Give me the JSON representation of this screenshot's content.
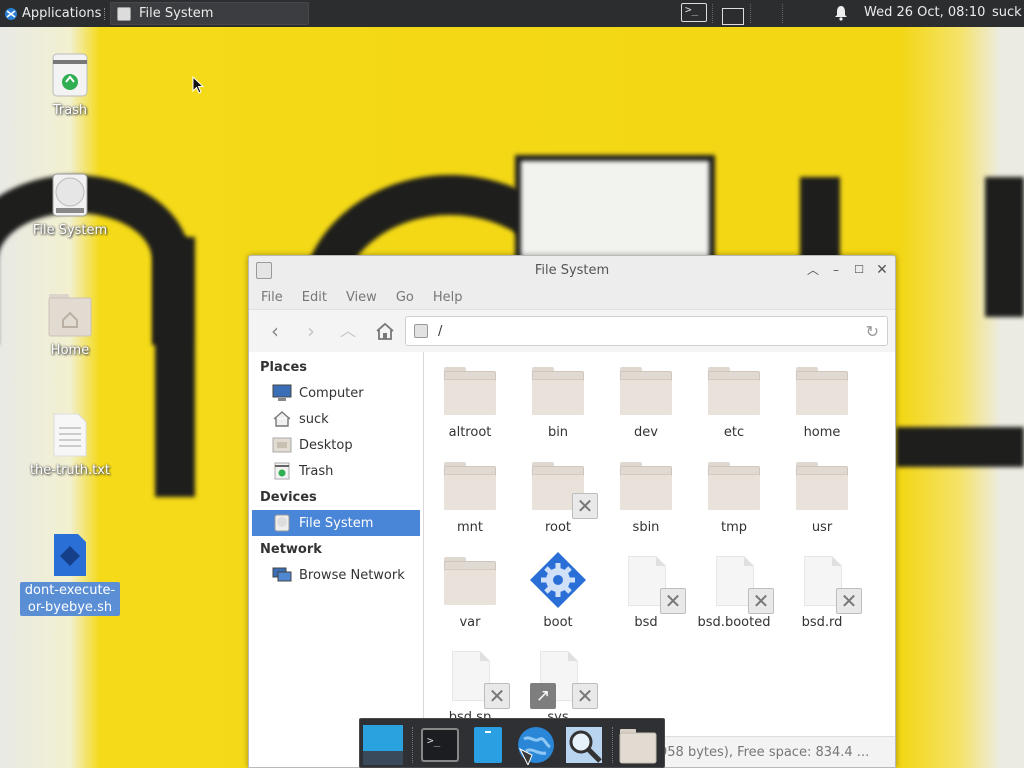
{
  "top_panel": {
    "apps_label": "Applications",
    "task_window_label": "File System",
    "clock": "Wed 26 Oct, 08:10",
    "user": "suck"
  },
  "desktop": {
    "icons": [
      {
        "label": "Trash"
      },
      {
        "label": "File System"
      },
      {
        "label": "Home"
      },
      {
        "label": "the-truth.txt"
      },
      {
        "label": "dont-execute-or-byebye.sh"
      }
    ]
  },
  "file_manager": {
    "title": "File System",
    "menu": [
      "File",
      "Edit",
      "View",
      "Go",
      "Help"
    ],
    "location": "/",
    "sidebar": {
      "places_header": "Places",
      "places": [
        "Computer",
        "suck",
        "Desktop",
        "Trash"
      ],
      "devices_header": "Devices",
      "devices": [
        "File System"
      ],
      "network_header": "Network",
      "network": [
        "Browse Network"
      ]
    },
    "items": [
      {
        "name": "altroot",
        "type": "folder"
      },
      {
        "name": "bin",
        "type": "folder"
      },
      {
        "name": "dev",
        "type": "folder"
      },
      {
        "name": "etc",
        "type": "folder"
      },
      {
        "name": "home",
        "type": "folder"
      },
      {
        "name": "mnt",
        "type": "folder"
      },
      {
        "name": "root",
        "type": "folder-locked"
      },
      {
        "name": "sbin",
        "type": "folder"
      },
      {
        "name": "tmp",
        "type": "folder"
      },
      {
        "name": "usr",
        "type": "folder"
      },
      {
        "name": "var",
        "type": "folder"
      },
      {
        "name": "boot",
        "type": "executable"
      },
      {
        "name": "bsd",
        "type": "file-locked"
      },
      {
        "name": "bsd.booted",
        "type": "file-locked"
      },
      {
        "name": "bsd.rd",
        "type": "file-locked"
      },
      {
        "name": "bsd.sp",
        "type": "file-locked"
      },
      {
        "name": "sys",
        "type": "link-locked"
      }
    ],
    "status": "958 bytes), Free space: 834.4 ..."
  },
  "colors": {
    "panel_bg": "#2b2d2f",
    "selection": "#4a86d8",
    "wallpaper": "#f3d614"
  }
}
